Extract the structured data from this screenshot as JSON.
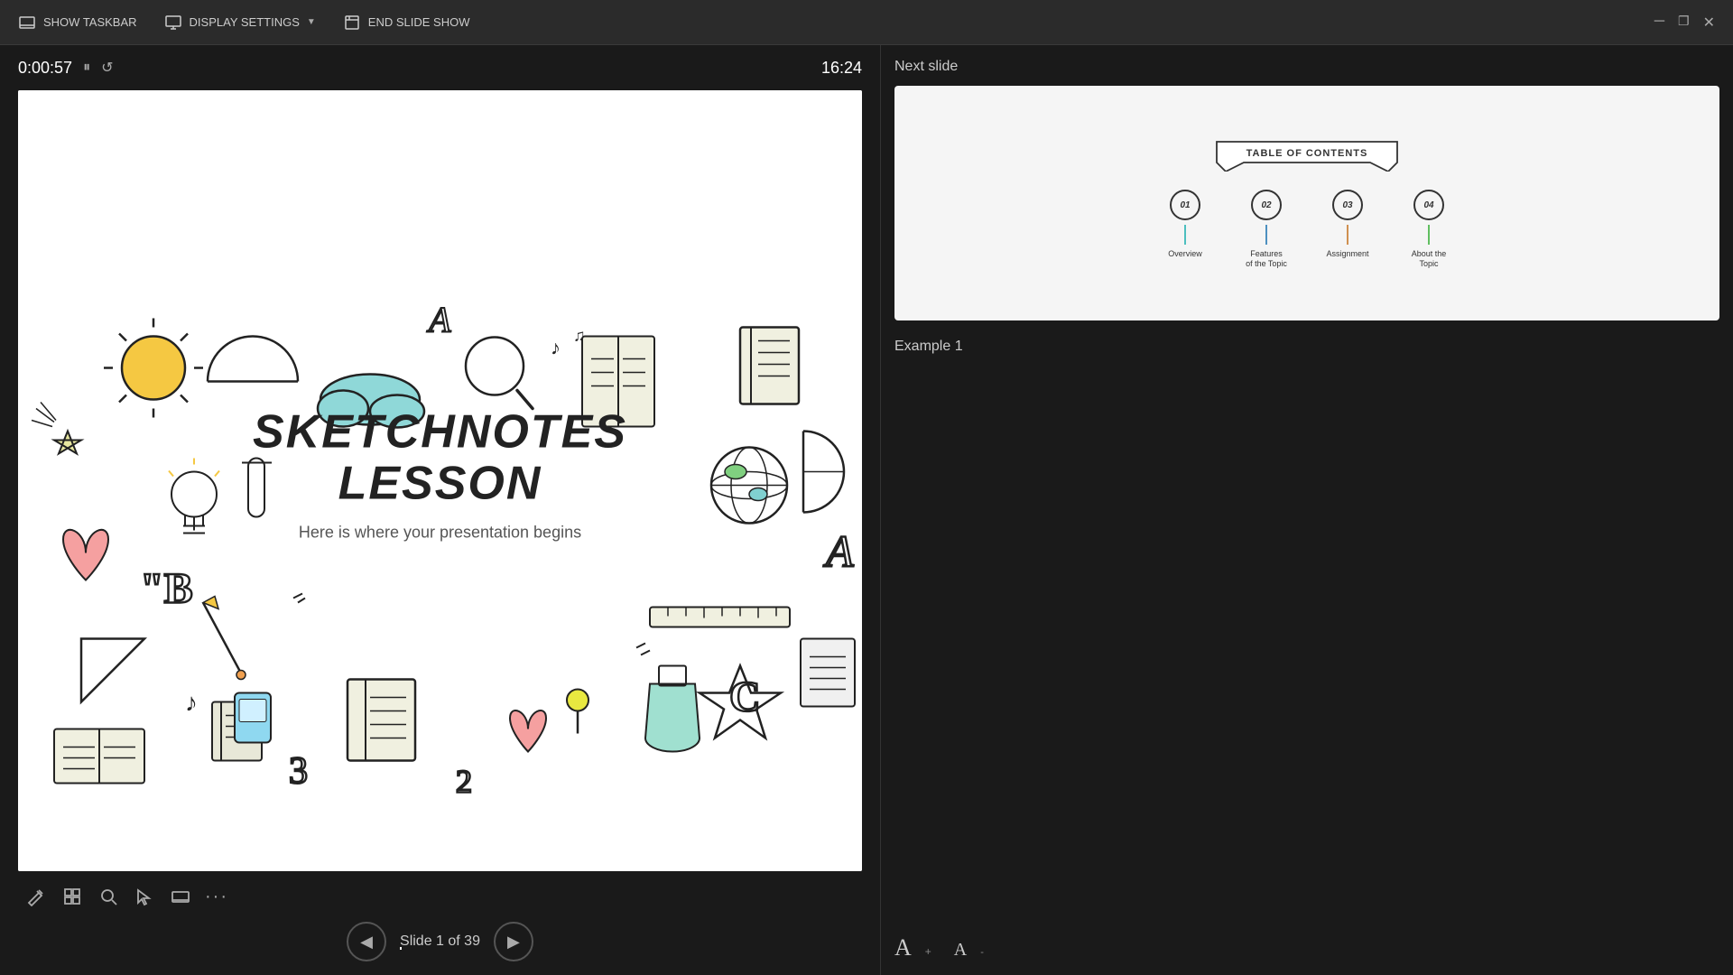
{
  "toolbar": {
    "show_taskbar_label": "SHOW TASKBAR",
    "display_settings_label": "DISPLAY SETTINGS",
    "end_slideshow_label": "END SLIDE SHOW"
  },
  "slide_header": {
    "timer": "0:00:57",
    "clock": "16:24"
  },
  "slide": {
    "title_line1": "SKETCHNOTES",
    "title_line2": "LESSON",
    "subtitle": "Here is where your presentation begins"
  },
  "navigation": {
    "slide_counter": "Slide 1 of 39",
    "prev_label": "◀",
    "next_label": "▶"
  },
  "right_panel": {
    "next_slide_label": "Next slide",
    "example_label": "Example 1",
    "toc_title": "TABLE OF CONTENTS",
    "toc_items": [
      {
        "number": "01",
        "label": "Overview",
        "arrow_color": "#4dbfbf"
      },
      {
        "number": "02",
        "label": "Features\nof the Topic",
        "arrow_color": "#4dbfbf"
      },
      {
        "number": "03",
        "label": "Assignment",
        "arrow_color": "#4dbfbf"
      },
      {
        "number": "04",
        "label": "About the\nTopic",
        "arrow_color": "#4dbfbf"
      }
    ]
  },
  "controls": {
    "pen_icon": "✏",
    "grid_icon": "⊞",
    "search_icon": "🔍",
    "pointer_icon": "↖",
    "display_icon": "▬",
    "more_icon": "⋯"
  },
  "font_controls": {
    "large_label": "A",
    "small_label": "A"
  }
}
